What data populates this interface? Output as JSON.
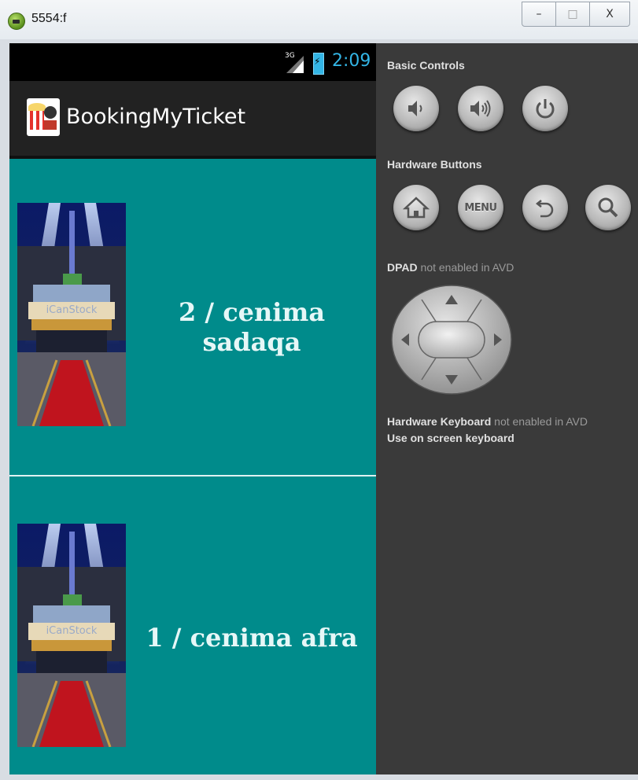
{
  "window": {
    "title": "5554:f",
    "minimize_label": "–",
    "maximize_label": "□",
    "close_label": "X"
  },
  "status_bar": {
    "network": "3G",
    "time": "2:09"
  },
  "action_bar": {
    "app_name": "BookingMyTicket"
  },
  "cinemas": [
    {
      "label": "2 / cenima sadaqa",
      "image_text": "iCanStock"
    },
    {
      "label": "1 / cenima afra",
      "image_text": "iCanStock"
    }
  ],
  "controls": {
    "basic_controls_title": "Basic Controls",
    "basic_buttons": [
      {
        "icon": "volume-down-icon"
      },
      {
        "icon": "volume-up-icon"
      },
      {
        "icon": "power-icon"
      }
    ],
    "hardware_buttons_title": "Hardware Buttons",
    "hardware_buttons": [
      {
        "icon": "home-icon"
      },
      {
        "icon": "menu-icon",
        "label": "MENU"
      },
      {
        "icon": "back-icon"
      },
      {
        "icon": "search-icon"
      }
    ],
    "dpad_title": "DPAD",
    "dpad_note": "not enabled in AVD",
    "keyboard_title": "Hardware Keyboard",
    "keyboard_note": "not enabled in AVD",
    "keyboard_line2": "Use on screen keyboard"
  },
  "colors": {
    "list_background": "#008b8b",
    "status_time": "#33b5e5",
    "panel_background": "#3a3a3a"
  }
}
